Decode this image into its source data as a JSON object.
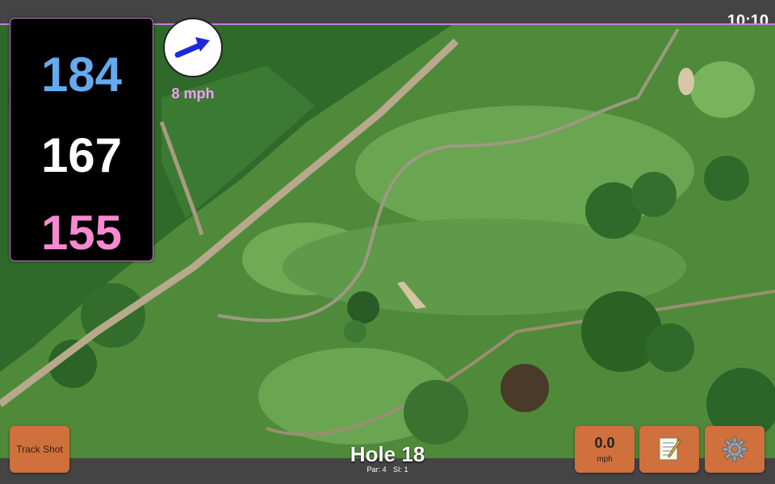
{
  "status": {
    "time": "10:10"
  },
  "distances": {
    "back": "184",
    "center": "167",
    "front": "155"
  },
  "wind": {
    "speed": "8 mph",
    "icon": "wind-arrow-icon",
    "direction": "east-northeast"
  },
  "controls": {
    "track_shot_label": "Track Shot",
    "speed_value": "0.0",
    "speed_unit": "mph",
    "notes_icon": "notepad-icon",
    "settings_icon": "gear-icon"
  },
  "hole": {
    "title": "Hole 18",
    "par": "Par: 4",
    "si": "SI: 1"
  },
  "colors": {
    "back": "#64aaf0",
    "center": "#ffffff",
    "front": "#f58ad0",
    "button": "#d0703c",
    "accent_line": "#c080e0"
  }
}
